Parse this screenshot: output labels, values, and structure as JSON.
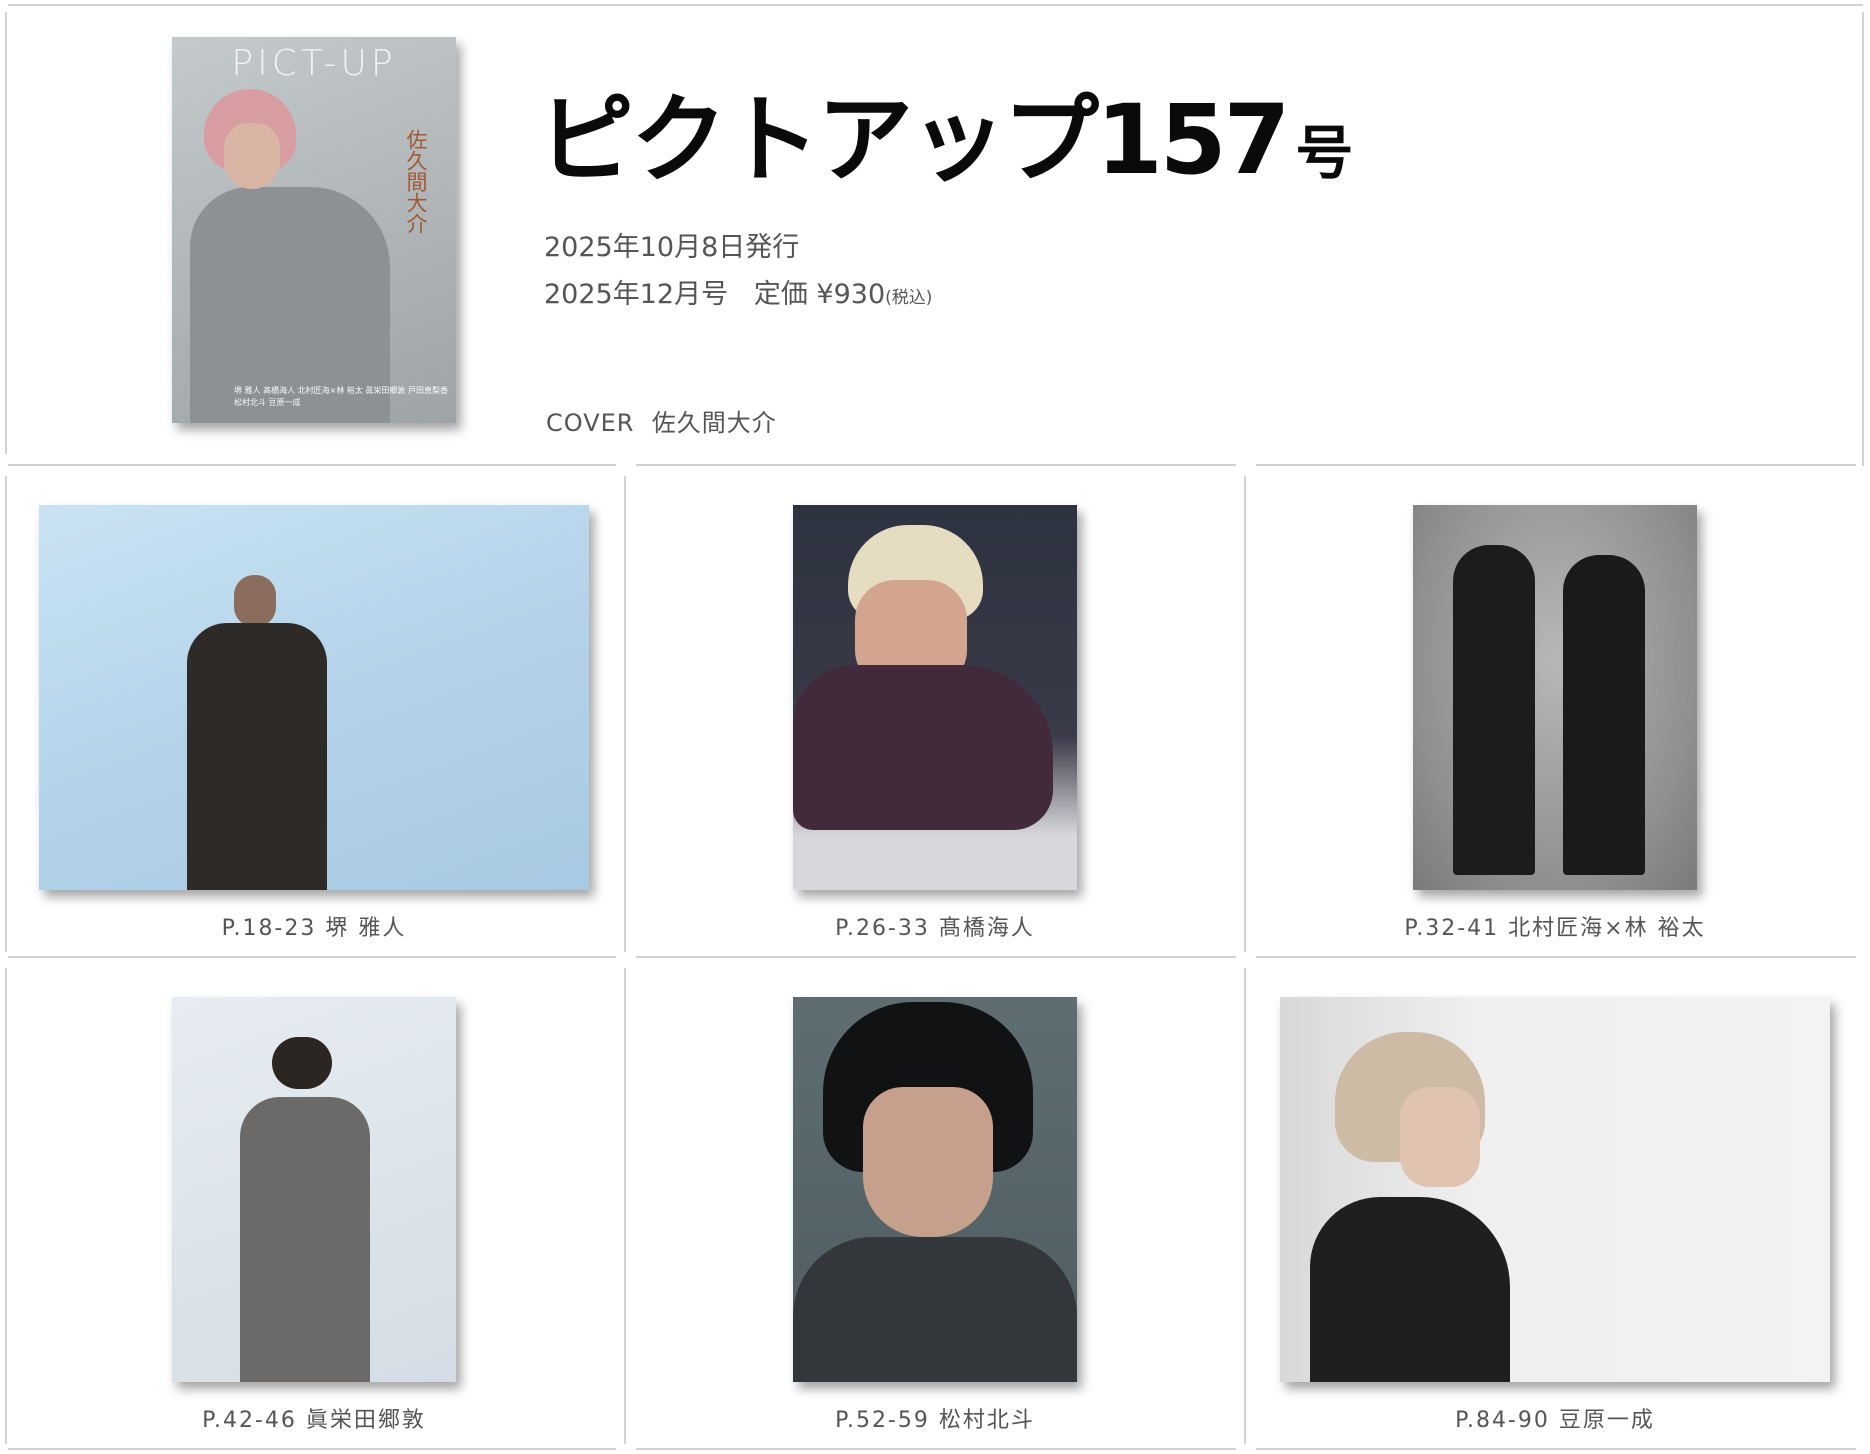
{
  "issue": {
    "title_main": "ピクトアップ157",
    "title_suffix": "号",
    "release": "2025年10月8日発行",
    "issue_month": "2025年12月号",
    "price_label": "定価",
    "price": "¥930",
    "tax_note": "(税込)",
    "cover_label": "COVER",
    "cover_person": "佐久間大介"
  },
  "cover_image": {
    "logo": "PICT-UP",
    "vertical_title": "佐久間大介",
    "credits": "堺 雅人 髙橋海人 北村匠海×林 裕太 眞栄田郷敦 戸田恵梨香 松村北斗 豆原一成"
  },
  "articles": [
    {
      "pages": "P.18-23",
      "name": "堺 雅人",
      "image": "portrait-photo"
    },
    {
      "pages": "P.26-33",
      "name": "髙橋海人",
      "image": "portrait-photo"
    },
    {
      "pages": "P.32-41",
      "name": "北村匠海×林 裕太",
      "image": "duo-photo"
    },
    {
      "pages": "P.42-46",
      "name": "眞栄田郷敦",
      "image": "portrait-photo"
    },
    {
      "pages": "P.52-59",
      "name": "松村北斗",
      "image": "portrait-photo"
    },
    {
      "pages": "P.84-90",
      "name": "豆原一成",
      "image": "portrait-photo"
    }
  ]
}
